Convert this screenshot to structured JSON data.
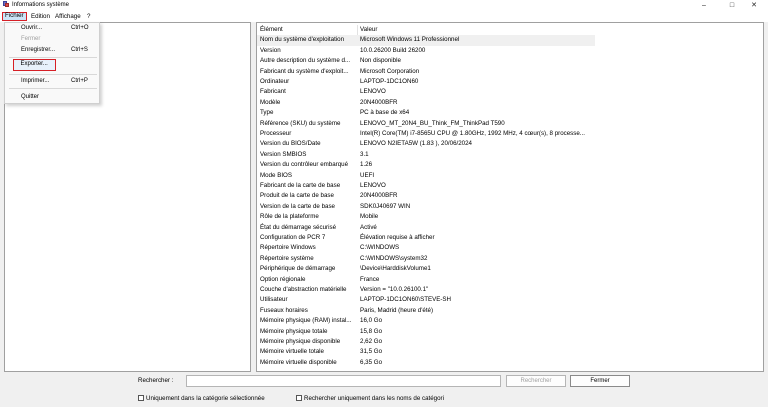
{
  "window": {
    "title": "Informations système",
    "controls": {
      "minimize": "–",
      "maximize": "□",
      "close": "✕"
    }
  },
  "menubar": {
    "items": [
      "Fichier",
      "Edition",
      "Affichage",
      "?"
    ]
  },
  "file_menu": {
    "items": [
      {
        "label": "Ouvrir...",
        "shortcut": "Ctrl+O",
        "disabled": false
      },
      {
        "label": "Fermer",
        "shortcut": "",
        "disabled": true
      },
      {
        "label": "Enregistrer...",
        "shortcut": "Ctrl+S",
        "disabled": false
      },
      {
        "label": "Exporter...",
        "shortcut": "",
        "disabled": false,
        "highlighted": true
      },
      {
        "label": "Imprimer...",
        "shortcut": "Ctrl+P",
        "disabled": false
      },
      {
        "label": "Quitter",
        "shortcut": "",
        "disabled": false
      }
    ]
  },
  "details": {
    "headers": {
      "key": "Élément",
      "value": "Valeur"
    },
    "rows": [
      [
        "Nom du système d'exploitation",
        "Microsoft Windows 11 Professionnel"
      ],
      [
        "Version",
        "10.0.26200 Build 26200"
      ],
      [
        "Autre description du système d...",
        "Non disponible"
      ],
      [
        "Fabricant du système d'exploit...",
        "Microsoft Corporation"
      ],
      [
        "Ordinateur",
        "LAPTOP-1DC1ON60"
      ],
      [
        "Fabricant",
        "LENOVO"
      ],
      [
        "Modèle",
        "20N4000BFR"
      ],
      [
        "Type",
        "PC à base de x64"
      ],
      [
        "Référence (SKU) du système",
        "LENOVO_MT_20N4_BU_Think_FM_ThinkPad T590"
      ],
      [
        "Processeur",
        "Intel(R) Core(TM) i7-8565U CPU @ 1.80GHz, 1992 MHz, 4 cœur(s), 8 processe..."
      ],
      [
        "Version du BIOS/Date",
        "LENOVO N2IETA5W (1.83 ), 20/06/2024"
      ],
      [
        "Version SMBIOS",
        "3.1"
      ],
      [
        "Version du contrôleur embarqué",
        "1.26"
      ],
      [
        "Mode BIOS",
        "UEFI"
      ],
      [
        "Fabricant de la carte de base",
        "LENOVO"
      ],
      [
        "Produit de la carte de base",
        "20N4000BFR"
      ],
      [
        "Version de la carte de base",
        "SDK0J40697 WIN"
      ],
      [
        "Rôle de la plateforme",
        "Mobile"
      ],
      [
        "État du démarrage sécurisé",
        "Activé"
      ],
      [
        "Configuration de PCR 7",
        "Élévation requise à afficher"
      ],
      [
        "Répertoire Windows",
        "C:\\WINDOWS"
      ],
      [
        "Répertoire système",
        "C:\\WINDOWS\\system32"
      ],
      [
        "Périphérique de démarrage",
        "\\Device\\HarddiskVolume1"
      ],
      [
        "Option régionale",
        "France"
      ],
      [
        "Couche d'abstraction matérielle",
        "Version = \"10.0.26100.1\""
      ],
      [
        "Utilisateur",
        "LAPTOP-1DC1ON60\\STEVE-SH"
      ],
      [
        "Fuseaux horaires",
        "Paris, Madrid (heure d'été)"
      ],
      [
        "Mémoire physique (RAM) instal...",
        "16,0 Go"
      ],
      [
        "Mémoire physique totale",
        "15,8 Go"
      ],
      [
        "Mémoire physique disponible",
        "2,62 Go"
      ],
      [
        "Mémoire virtuelle totale",
        "31,5 Go"
      ],
      [
        "Mémoire virtuelle disponible",
        "6,35 Go"
      ]
    ]
  },
  "search": {
    "label": "Rechercher :",
    "value": "",
    "search_button": "Rechercher",
    "close_button": "Fermer",
    "option_category": "Uniquement dans la catégorie sélectionnée",
    "option_names": "Rechercher uniquement dans les noms de catégori"
  }
}
